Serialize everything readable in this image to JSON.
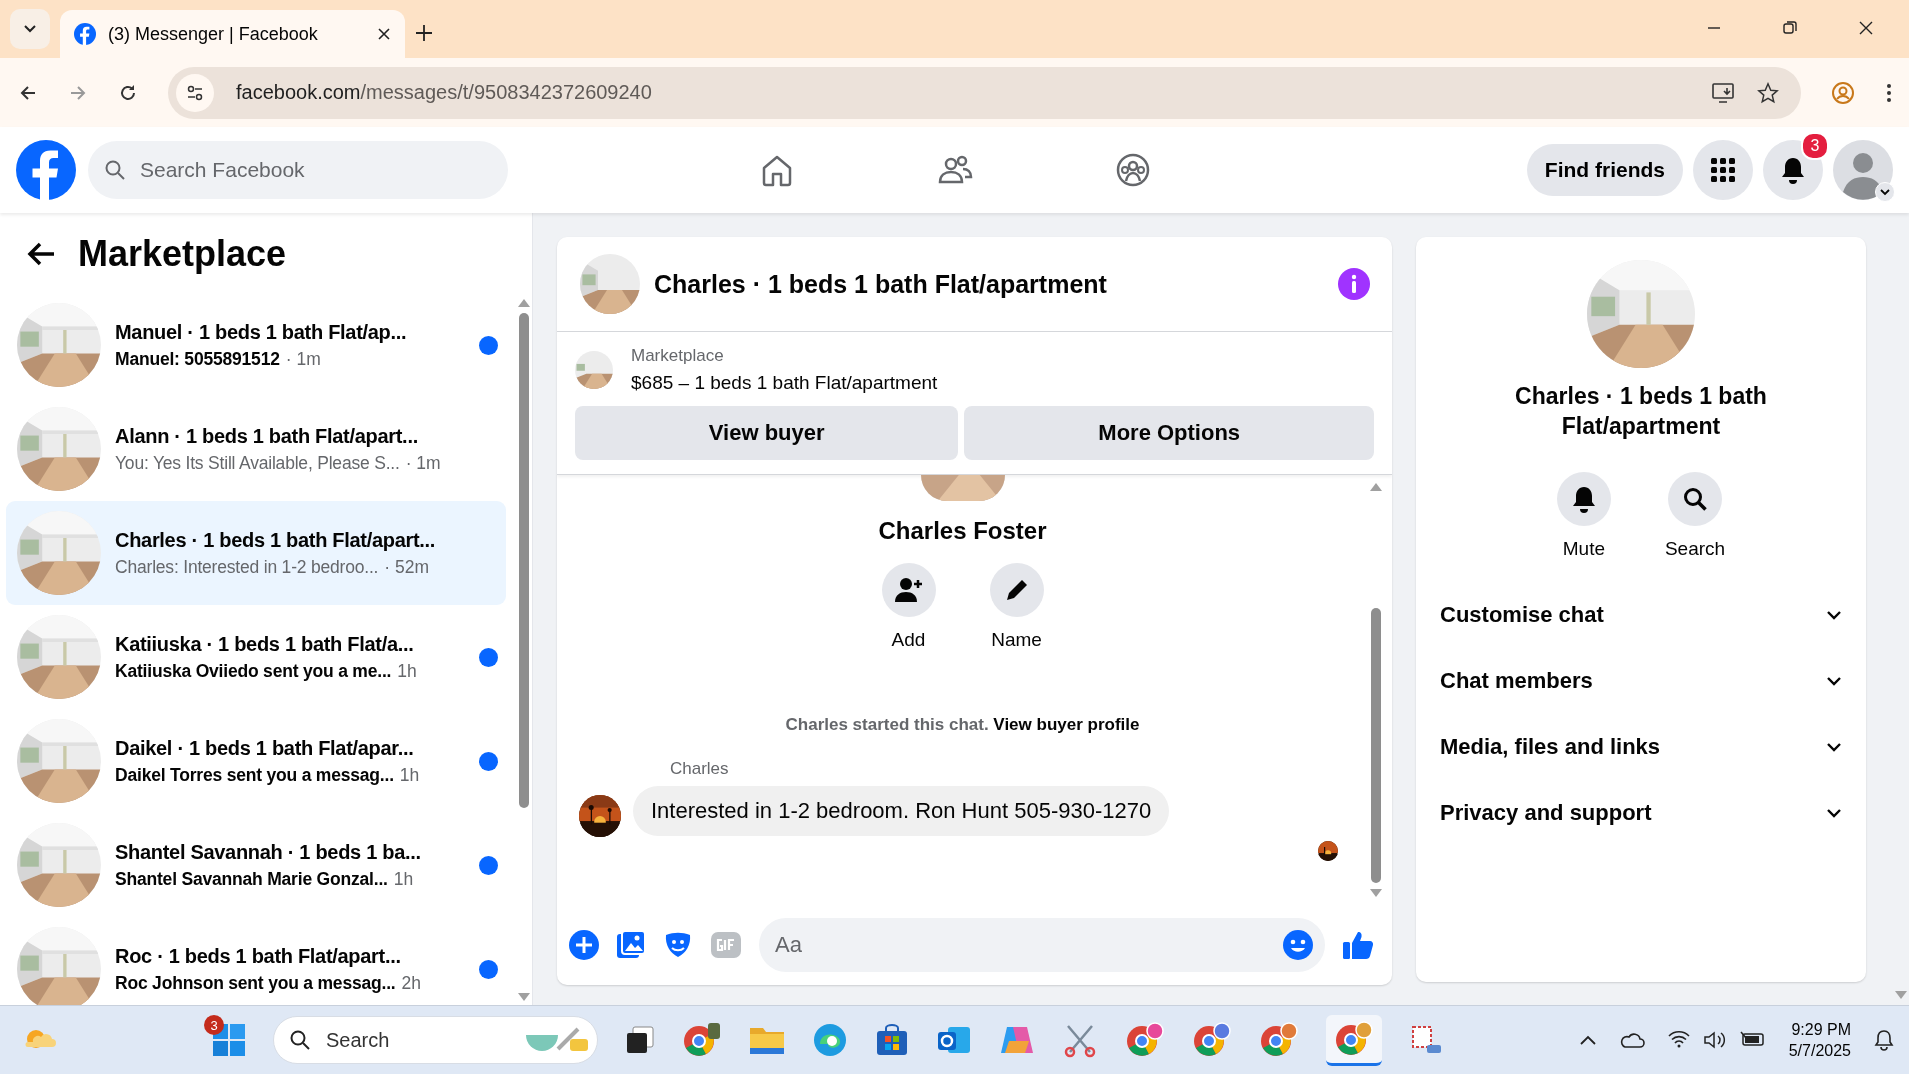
{
  "browser": {
    "tab_title": "(3) Messenger | Facebook",
    "url_host": "facebook.com",
    "url_path": "/messages/t/9508342372609240"
  },
  "header": {
    "search_placeholder": "Search Facebook",
    "find_friends": "Find friends",
    "notification_count": "3"
  },
  "sidebar": {
    "title": "Marketplace",
    "conversations": [
      {
        "title": "Manuel · 1 beds 1 bath Flat/ap...",
        "preview": "Manuel: 5055891512",
        "time": "· 1m",
        "unread": true,
        "selected": false
      },
      {
        "title": "Alann · 1 beds 1 bath Flat/apart...",
        "preview": "You: Yes Its Still Available, Please S...",
        "time": "· 1m",
        "unread": false,
        "selected": false
      },
      {
        "title": "Charles · 1 beds 1 bath Flat/apart...",
        "preview": "Charles: Interested in 1-2 bedroo...",
        "time": "· 52m",
        "unread": false,
        "selected": true
      },
      {
        "title": "Katiiuska · 1 beds 1 bath Flat/a...",
        "preview": "Katiiuska Oviiedo sent you a me...",
        "time": "1h",
        "unread": true,
        "selected": false
      },
      {
        "title": "Daikel · 1 beds 1 bath Flat/apar...",
        "preview": "Daikel Torres sent you a messag...",
        "time": "1h",
        "unread": true,
        "selected": false
      },
      {
        "title": "Shantel Savannah · 1 beds 1 ba...",
        "preview": "Shantel Savannah Marie Gonzal...",
        "time": "1h",
        "unread": true,
        "selected": false
      },
      {
        "title": "Roc · 1 beds 1 bath Flat/apart...",
        "preview": "Roc Johnson sent you a messag...",
        "time": "2h",
        "unread": true,
        "selected": false
      }
    ]
  },
  "chat": {
    "title": "Charles · 1 beds 1 bath Flat/apartment",
    "listing": {
      "source": "Marketplace",
      "text": "$685 – 1 beds 1 bath Flat/apartment"
    },
    "buttons": [
      "View buyer",
      "More Options"
    ],
    "profile_name": "Charles Foster",
    "profile_actions": [
      {
        "kind": "add",
        "label": "Add"
      },
      {
        "kind": "name",
        "label": "Name"
      }
    ],
    "notice": "Charles started this chat.",
    "notice_link": "View buyer profile",
    "message": {
      "sender": "Charles",
      "text": "Interested in 1-2 bedroom. Ron Hunt 505-930-1270"
    },
    "composer_placeholder": "Aa"
  },
  "details": {
    "title": "Charles · 1 beds 1 bath Flat/apartment",
    "actions": [
      {
        "kind": "mute",
        "label": "Mute"
      },
      {
        "kind": "search",
        "label": "Search"
      }
    ],
    "sections": [
      "Customise chat",
      "Chat members",
      "Media, files and links",
      "Privacy and support"
    ]
  },
  "taskbar": {
    "widget_badge": "3",
    "search_placeholder": "Search",
    "time": "9:29 PM",
    "date": "5/7/2025"
  }
}
